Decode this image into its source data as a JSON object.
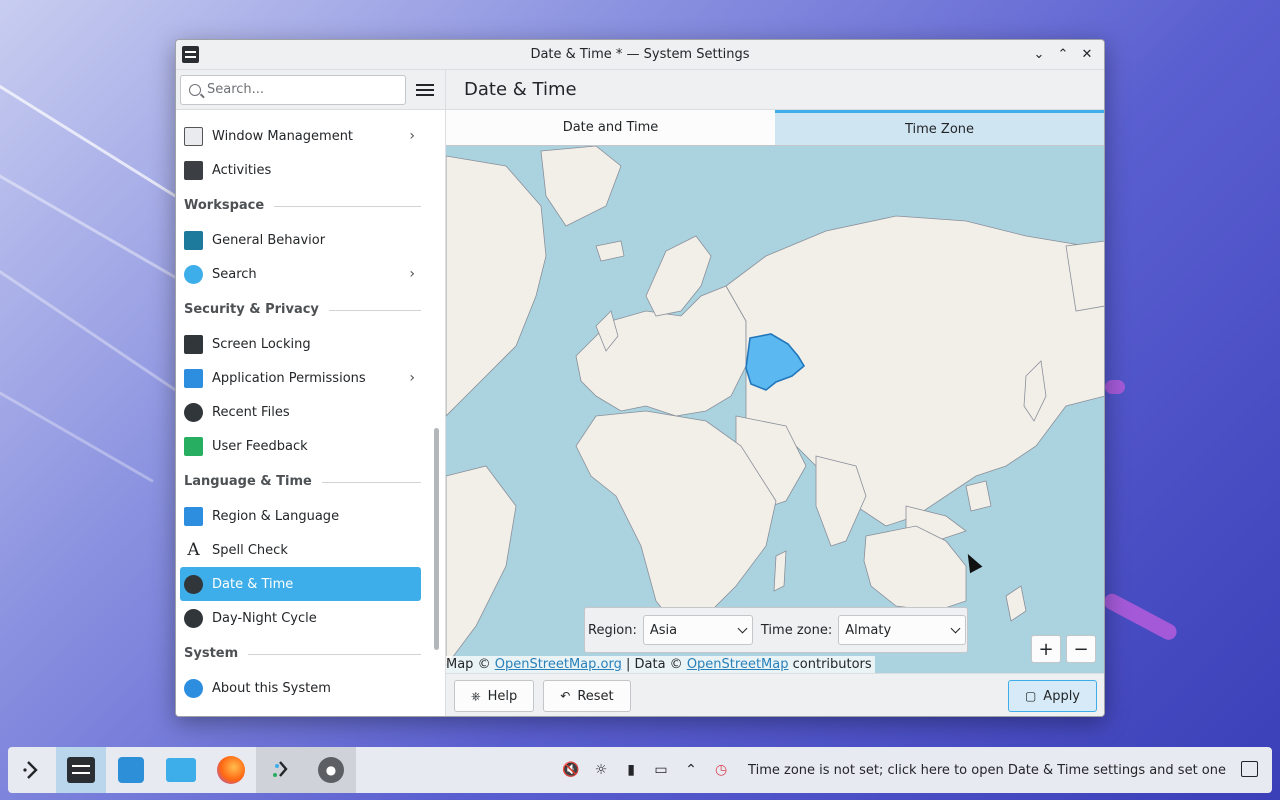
{
  "window": {
    "title": "Date & Time * — System Settings"
  },
  "search": {
    "placeholder": "Search..."
  },
  "page_title": "Date & Time",
  "sidebar": {
    "items": [
      {
        "label": "Window Management",
        "icon": "window-management-icon",
        "has_children": true
      },
      {
        "label": "Activities",
        "icon": "activities-icon",
        "has_children": false
      },
      {
        "section": "Workspace"
      },
      {
        "label": "General Behavior",
        "icon": "general-behavior-icon",
        "has_children": false
      },
      {
        "label": "Search",
        "icon": "search-settings-icon",
        "has_children": true
      },
      {
        "section": "Security & Privacy"
      },
      {
        "label": "Screen Locking",
        "icon": "screen-locking-icon",
        "has_children": false
      },
      {
        "label": "Application Permissions",
        "icon": "application-permissions-icon",
        "has_children": true
      },
      {
        "label": "Recent Files",
        "icon": "recent-files-icon",
        "has_children": false
      },
      {
        "label": "User Feedback",
        "icon": "user-feedback-icon",
        "has_children": false
      },
      {
        "section": "Language & Time"
      },
      {
        "label": "Region & Language",
        "icon": "region-language-icon",
        "has_children": false
      },
      {
        "label": "Spell Check",
        "icon": "spell-check-icon",
        "has_children": false
      },
      {
        "label": "Date & Time",
        "icon": "date-time-icon",
        "has_children": false,
        "active": true
      },
      {
        "label": "Day-Night Cycle",
        "icon": "day-night-cycle-icon",
        "has_children": false
      },
      {
        "section": "System"
      },
      {
        "label": "About this System",
        "icon": "about-system-icon",
        "has_children": false
      }
    ]
  },
  "tabs": [
    {
      "label": "Date and Time",
      "selected": false
    },
    {
      "label": "Time Zone",
      "selected": true
    }
  ],
  "timezone": {
    "region_label": "Region:",
    "region_value": "Asia",
    "zone_label": "Time zone:",
    "zone_value": "Almaty"
  },
  "map": {
    "attribution_prefix": "Map ©",
    "osm_link": "OpenStreetMap.org",
    "attribution_mid": "| Data ©",
    "osm_data_link": "OpenStreetMap",
    "attribution_suffix": "contributors",
    "zoom_in": "+",
    "zoom_out": "−",
    "highlight_color": "#5bb8f0",
    "water_color": "#aad3df",
    "land_color": "#f2efe9"
  },
  "buttons": {
    "help": "Help",
    "reset": "Reset",
    "apply": "Apply"
  },
  "taskbar": {
    "tray_message": "Time zone is not set; click here to open Date & Time settings and set one",
    "tray_icons": [
      "volume-muted-icon",
      "brightness-icon",
      "usb-icon",
      "display-icon",
      "expand-tray-icon",
      "clock-alert-icon"
    ]
  },
  "colors": {
    "accent": "#3daee9"
  }
}
